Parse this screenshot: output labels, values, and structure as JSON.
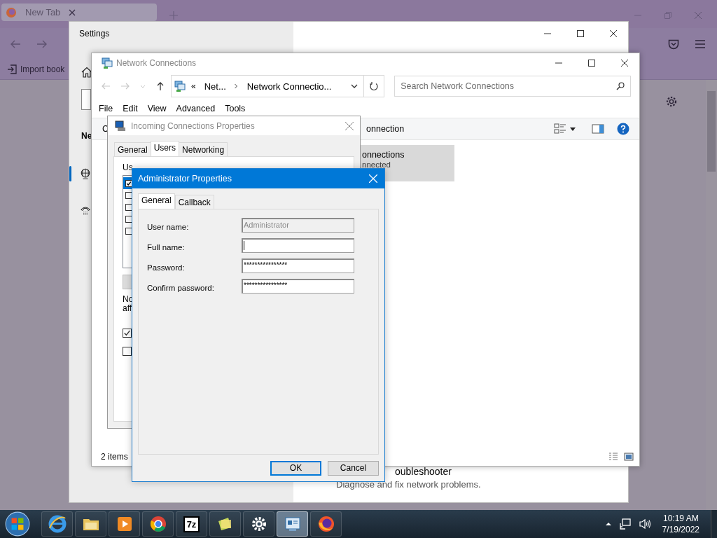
{
  "browser": {
    "tab": {
      "title": "New Tab"
    },
    "bookmarks": [
      {
        "label": "Import book"
      }
    ]
  },
  "settings": {
    "title": "Settings",
    "nav_heading": "Ne",
    "nav_items": [
      {
        "kind": "globe",
        "selected": true
      },
      {
        "kind": "phone",
        "selected": false
      }
    ],
    "troubleshooter": {
      "title": "oubleshooter",
      "description": "Diagnose and fix network problems."
    }
  },
  "network_connections": {
    "title": "Network Connections",
    "address": {
      "overflow": "«",
      "crumbs": [
        "Net...",
        "Network Connectio..."
      ]
    },
    "search": {
      "placeholder": "Search Network Connections"
    },
    "menu": [
      "File",
      "Edit",
      "View",
      "Advanced",
      "Tools"
    ],
    "command_bar": {
      "left": "C",
      "right": "onnection"
    },
    "items": [
      {
        "name": "onnections",
        "status": "nnected",
        "selected": true
      }
    ],
    "status_bar": "2 items"
  },
  "incoming_properties": {
    "title": "Incoming Connections Properties",
    "tabs": [
      {
        "label": "General",
        "selected": false
      },
      {
        "label": "Users",
        "selected": true
      },
      {
        "label": "Networking",
        "selected": false
      }
    ],
    "users_label": "Us",
    "users": [
      {
        "checked": true,
        "selected": true
      },
      {
        "checked": false,
        "selected": false
      },
      {
        "checked": false,
        "selected": false
      },
      {
        "checked": false,
        "selected": false
      },
      {
        "checked": false,
        "selected": false
      }
    ],
    "note": [
      "No",
      "aff"
    ],
    "options": [
      {
        "checked": true
      },
      {
        "checked": false
      }
    ]
  },
  "administrator_properties": {
    "title": "Administrator Properties",
    "tabs": [
      {
        "label": "General",
        "selected": true
      },
      {
        "label": "Callback",
        "selected": false
      }
    ],
    "fields": [
      {
        "label": "User name:",
        "value": "Administrator",
        "disabled": true,
        "focused": false
      },
      {
        "label": "Full name:",
        "disabled": false,
        "focused": true
      },
      {
        "label": "Password:",
        "value": "****************",
        "disabled": false,
        "focused": false
      },
      {
        "label": "Confirm password:",
        "value": "****************",
        "disabled": false,
        "focused": false
      }
    ],
    "buttons": [
      {
        "label": "OK",
        "default": true
      },
      {
        "label": "Cancel",
        "default": false
      }
    ]
  },
  "taskbar": {
    "apps": [
      {
        "kind": "ie",
        "selected": false
      },
      {
        "kind": "folder",
        "selected": false
      },
      {
        "kind": "media",
        "selected": false
      },
      {
        "kind": "chrome",
        "selected": false
      },
      {
        "kind": "archive",
        "label": "7z",
        "selected": false
      },
      {
        "kind": "notes",
        "selected": false
      },
      {
        "kind": "gear",
        "selected": false
      },
      {
        "kind": "network",
        "selected": true
      },
      {
        "kind": "firefox",
        "selected": false
      }
    ],
    "clock": {
      "time": "10:19 AM",
      "date": "7/19/2022"
    }
  }
}
